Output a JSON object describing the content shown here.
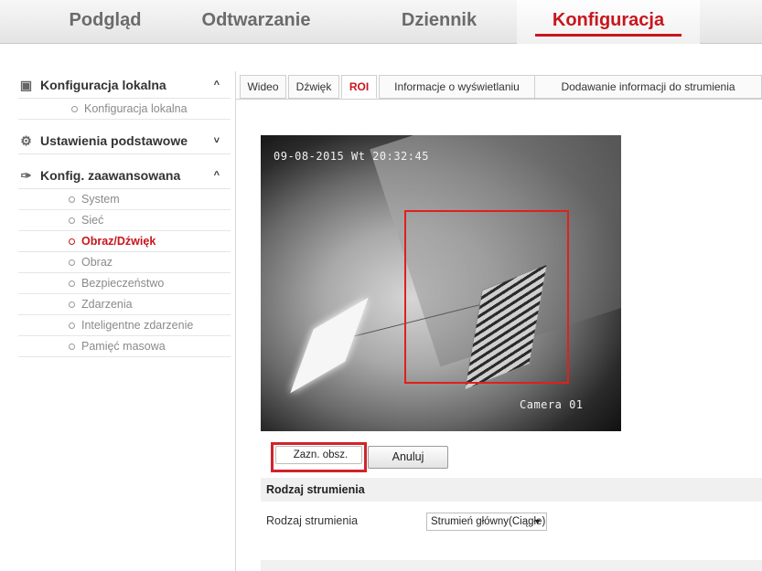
{
  "topnav": {
    "tabs": [
      {
        "label": "Podgląd"
      },
      {
        "label": "Odtwarzanie"
      },
      {
        "label": "Dziennik"
      },
      {
        "label": "Konfiguracja"
      }
    ]
  },
  "sidebar": {
    "groups": [
      {
        "label": "Konfiguracja lokalna",
        "caret": "^",
        "icon": "monitor-icon"
      },
      {
        "label": "Ustawienia podstawowe",
        "caret": "˅",
        "icon": "gear-icon"
      },
      {
        "label": "Konfig. zaawansowana",
        "caret": "^",
        "icon": "wrench-icon"
      }
    ],
    "local_items": [
      "Konfiguracja lokalna"
    ],
    "advanced_items": [
      "System",
      "Sieć",
      "Obraz/Dźwięk",
      "Obraz",
      "Bezpieczeństwo",
      "Zdarzenia",
      "Inteligentne zdarzenie",
      "Pamięć masowa"
    ]
  },
  "content_tabs": [
    "Wideo",
    "Dźwięk",
    "ROI",
    "Informacje o wyświetlaniu",
    "Dodawanie informacji do strumienia"
  ],
  "video": {
    "osd_datetime": "09-08-2015 Wt  20:32:45",
    "osd_camera": "Camera 01"
  },
  "buttons": {
    "select_area": "Zazn. obsz.",
    "cancel": "Anuluj"
  },
  "stream_section": {
    "title": "Rodzaj strumienia",
    "field_label": "Rodzaj strumienia",
    "field_value": "Strumień główny(Ciągłe)"
  },
  "colors": {
    "accent": "#c8161d",
    "highlight_frame": "#d2232a",
    "roi_box": "#e0201c"
  }
}
